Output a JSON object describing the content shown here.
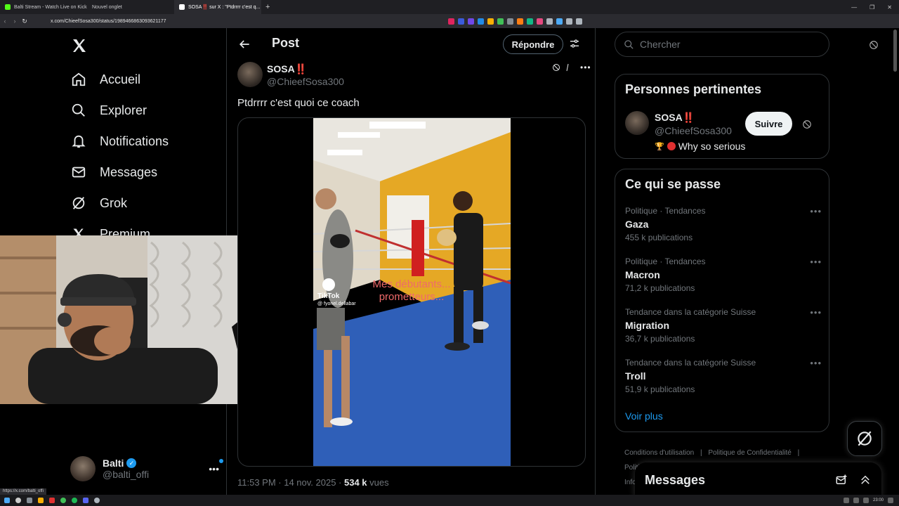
{
  "browser": {
    "tabs": [
      {
        "label": "Balti Stream - Watch Live on Kick",
        "color": "#53fc18"
      },
      {
        "label": "Nouvel onglet",
        "color": "#444444"
      },
      {
        "label": "SOSA‼️ sur X : \"Ptdrrrr c'est q...",
        "color": "#ffffff"
      }
    ],
    "new_tab": "+",
    "url": "x.com/ChieefSosa300/status/1989466863093621177"
  },
  "nav": {
    "items": [
      {
        "label": "Accueil",
        "icon": "home-icon"
      },
      {
        "label": "Explorer",
        "icon": "search-icon"
      },
      {
        "label": "Notifications",
        "icon": "bell-icon"
      },
      {
        "label": "Messages",
        "icon": "mail-icon"
      },
      {
        "label": "Grok",
        "icon": "grok-icon"
      },
      {
        "label": "Premium",
        "icon": "x-icon"
      }
    ],
    "account": {
      "name": "Balti",
      "handle": "@balti_offi"
    }
  },
  "post": {
    "header_title": "Post",
    "reply_label": "Répondre",
    "author_name": "SOSA",
    "author_emoji": "‼️",
    "author_handle": "@ChieefSosa300",
    "text": "Ptdrrrr c'est quoi ce coach",
    "video_overlay": {
      "tiktok_label": "TikTok",
      "tiktok_user": "@ fyonel.dellabar",
      "caption_line1": "Mes débutants...",
      "caption_line2": "prometteurs..."
    },
    "time": "11:53 PM · 14 nov. 2025 · ",
    "views_count": "534 k",
    "views_label": " vues"
  },
  "sidebar": {
    "search_placeholder": "Chercher",
    "relevant": {
      "title": "Personnes pertinentes",
      "name": "SOSA",
      "emoji": "‼️",
      "handle": "@ChieefSosa300",
      "bio": "Why so serious",
      "follow_label": "Suivre"
    },
    "trends_title": "Ce qui se passe",
    "trends": [
      {
        "category": "Politique · Tendances",
        "name": "Gaza",
        "count": "455 k publications"
      },
      {
        "category": "Politique · Tendances",
        "name": "Macron",
        "count": "71,2 k publications"
      },
      {
        "category": "Tendance dans la catégorie Suisse",
        "name": "Migration",
        "count": "36,7 k publications"
      },
      {
        "category": "Tendance dans la catégorie Suisse",
        "name": "Troll",
        "count": "51,9 k publications"
      }
    ],
    "see_more": "Voir plus",
    "footer": {
      "terms": "Conditions d'utilisation",
      "privacy": "Politique de Confidentialité",
      "line2_start": "Politi",
      "line3_start": "Info"
    },
    "messages_dock_title": "Messages"
  },
  "status_url": "https://x.com/balti_offi",
  "taskbar": {
    "time": "23:00"
  }
}
